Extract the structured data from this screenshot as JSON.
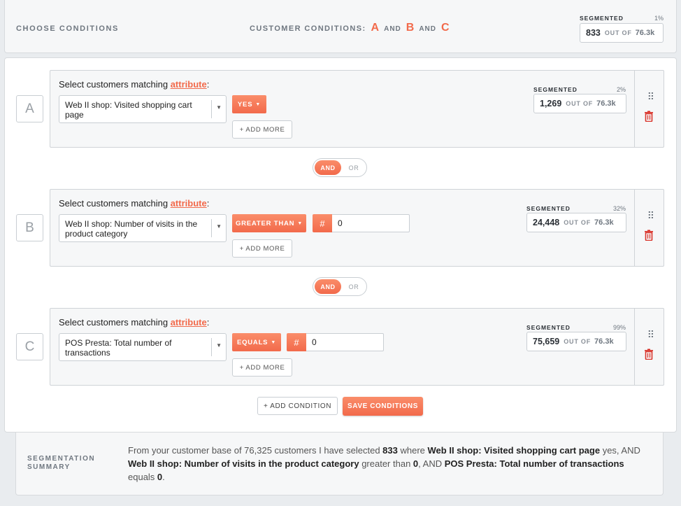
{
  "header": {
    "choose_label": "CHOOSE CONDITIONS",
    "customer_conditions_label": "CUSTOMER CONDITIONS:",
    "letters": [
      "A",
      "B",
      "C"
    ],
    "and_word": "AND",
    "segmented": {
      "label": "SEGMENTED",
      "percent": "1%",
      "count": "833",
      "out_of": "OUT OF",
      "total": "76.3k"
    }
  },
  "conditions": [
    {
      "letter": "A",
      "title_prefix": "Select customers matching",
      "title_link": "attribute",
      "title_suffix": ":",
      "attribute": "Web II shop: Visited shopping cart page",
      "operator": "YES",
      "value": null,
      "add_more": "+ ADD MORE",
      "segmented": {
        "label": "SEGMENTED",
        "percent": "2%",
        "count": "1,269",
        "out_of": "OUT OF",
        "total": "76.3k"
      }
    },
    {
      "letter": "B",
      "title_prefix": "Select customers matching",
      "title_link": "attribute",
      "title_suffix": ":",
      "attribute": "Web II shop: Number of visits in the product category",
      "operator": "GREATER THAN",
      "hash": "#",
      "value": "0",
      "add_more": "+ ADD MORE",
      "segmented": {
        "label": "SEGMENTED",
        "percent": "32%",
        "count": "24,448",
        "out_of": "OUT OF",
        "total": "76.3k"
      }
    },
    {
      "letter": "C",
      "title_prefix": "Select customers matching",
      "title_link": "attribute",
      "title_suffix": ":",
      "attribute": "POS Presta: Total number of transactions",
      "operator": "EQUALS",
      "hash": "#",
      "value": "0",
      "add_more": "+ ADD MORE",
      "segmented": {
        "label": "SEGMENTED",
        "percent": "99%",
        "count": "75,659",
        "out_of": "OUT OF",
        "total": "76.3k"
      }
    }
  ],
  "toggles": [
    {
      "on": "AND",
      "off": "OR"
    },
    {
      "on": "AND",
      "off": "OR"
    }
  ],
  "buttons": {
    "add_condition": "+ ADD CONDITION",
    "save_conditions": "SAVE CONDITIONS"
  },
  "summary": {
    "label": "SEGMENTATION SUMMARY",
    "parts": {
      "p1": "From your customer base of 76,325 customers I have selected ",
      "b1": "833",
      "p2": " where ",
      "b2": "Web II shop: Visited shopping cart page",
      "p3": " yes, AND ",
      "b3": "Web II shop: Number of visits in the product category",
      "p4": " greater than ",
      "b4": "0",
      "p5": ", AND ",
      "b5": "POS Presta: Total number of transactions",
      "p6": " equals ",
      "b6": "0",
      "p7": "."
    }
  },
  "icons": {
    "drag": "drag-handle-icon",
    "delete": "trash-icon",
    "caret": "chevron-down-icon"
  },
  "colors": {
    "accent": "#f26a4b",
    "delete": "#d9342b"
  }
}
